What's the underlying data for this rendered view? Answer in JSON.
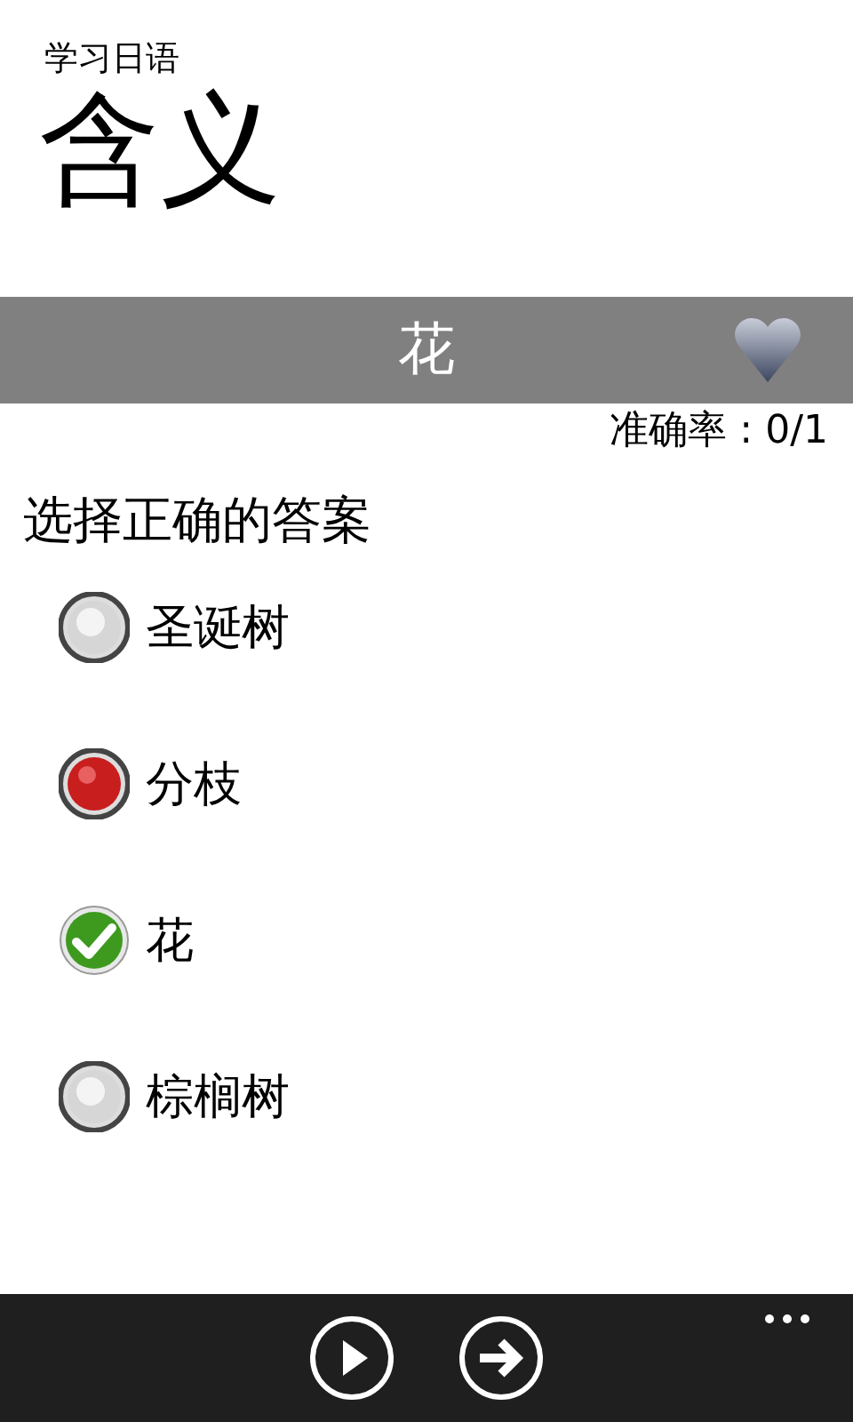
{
  "app_title": "学习日语",
  "page_title": "含义",
  "word_bar": {
    "word": "花",
    "favorite": false
  },
  "accuracy": "准确率 : 0/1",
  "prompt": "选择正确的答案",
  "options": [
    {
      "label": "圣诞树",
      "kind": "neutral"
    },
    {
      "label": "分枝",
      "kind": "wrong"
    },
    {
      "label": "花",
      "kind": "correct"
    },
    {
      "label": "棕榈树",
      "kind": "neutral"
    }
  ],
  "app_bar": {
    "buttons": [
      {
        "kind": "play"
      },
      {
        "kind": "next"
      }
    ]
  }
}
